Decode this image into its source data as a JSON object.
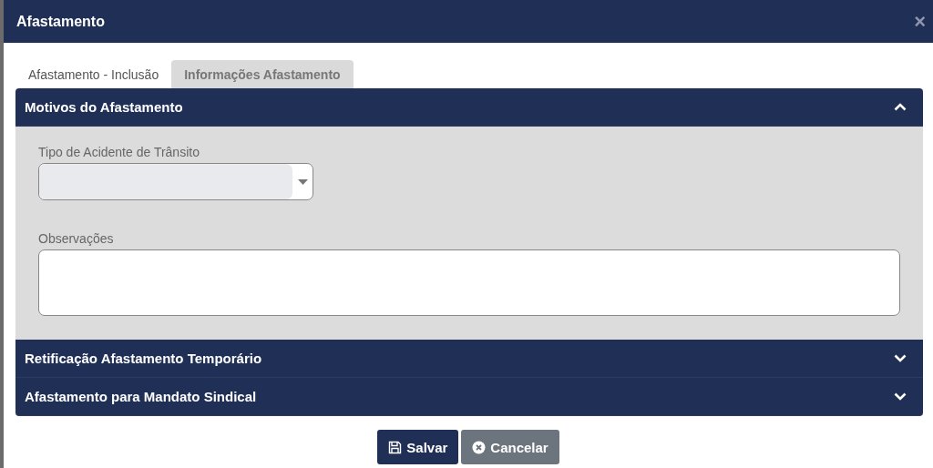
{
  "window": {
    "title": "Afastamento",
    "close": "×"
  },
  "tabs": [
    {
      "label": "Afastamento - Inclusão",
      "selected": false
    },
    {
      "label": "Informações Afastamento",
      "selected": true
    }
  ],
  "sections": [
    {
      "title": "Motivos do Afastamento",
      "expanded": true,
      "fields": [
        {
          "kind": "select",
          "label": "Tipo de Acidente de Trânsito"
        },
        {
          "kind": "textarea",
          "label": "Observações"
        }
      ]
    },
    {
      "title": "Retificação Afastamento Temporário",
      "expanded": false
    },
    {
      "title": "Afastamento para Mandato Sindical",
      "expanded": false
    }
  ],
  "buttons": [
    {
      "label": "Salvar",
      "kind": "primary"
    },
    {
      "label": "Cancelar",
      "kind": "secondary"
    }
  ]
}
